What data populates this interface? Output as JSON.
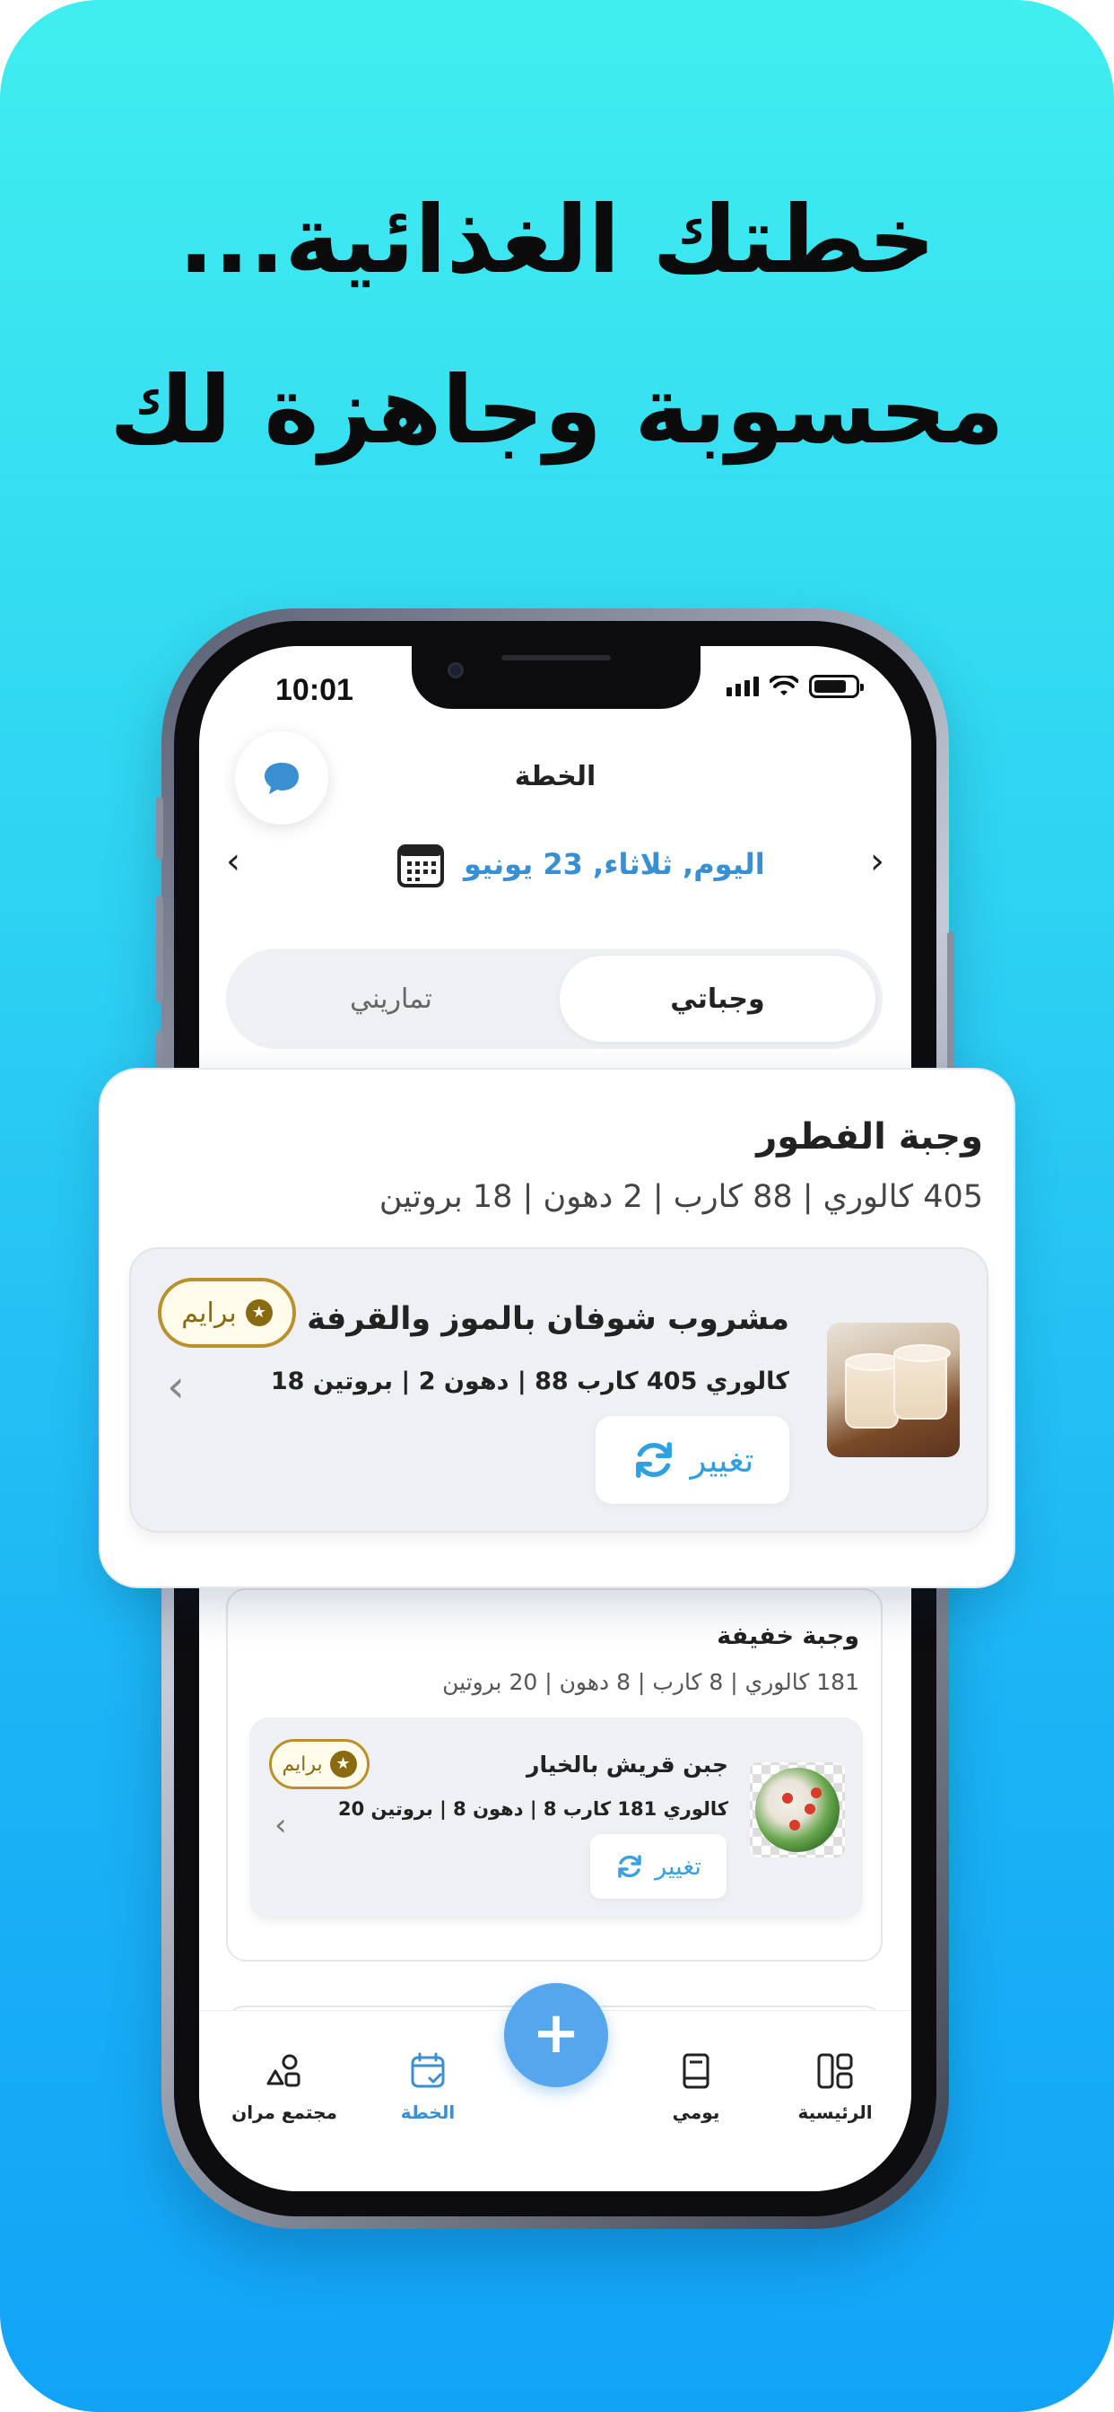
{
  "headline": {
    "line1": "خطتك الغذائية...",
    "line2": "محسوبة وجاهزة لك"
  },
  "status_bar": {
    "time": "10:01"
  },
  "screen": {
    "title": "الخطة",
    "date": "اليوم, ثلاثاء, 23 يونيو",
    "tabs": {
      "meals": "وجباتي",
      "workouts": "تماريني"
    }
  },
  "breakfast": {
    "title": "وجبة الفطور",
    "macros": "405 كالوري | 88 كارب | 2 دهون | 18 بروتين",
    "item": {
      "name": "مشروب شوفان بالموز والقرفة",
      "nutrition": "كالوري 405  كارب 88  |  دهون 2  |  بروتين 18",
      "change_label": "تغيير",
      "premium_label": "برايم"
    }
  },
  "snack": {
    "title": "وجبة خفيفة",
    "macros": "181 كالوري | 8 كارب | 8 دهون | 20 بروتين",
    "item": {
      "name": "جبن قريش بالخيار",
      "nutrition": "كالوري 181  كارب 8  |  دهون 8  |  بروتين 20",
      "change_label": "تغيير",
      "premium_label": "برايم"
    }
  },
  "tabbar": {
    "home": "الرئيسية",
    "diary": "يومي",
    "add": "+",
    "plan": "الخطة",
    "community": "مجتمع مران"
  },
  "colors": {
    "accent": "#3a8fd0",
    "fab": "#56a6ee",
    "premium": "#b8912a",
    "bg_top": "#40eeef",
    "bg_bottom": "#12a3f7"
  }
}
